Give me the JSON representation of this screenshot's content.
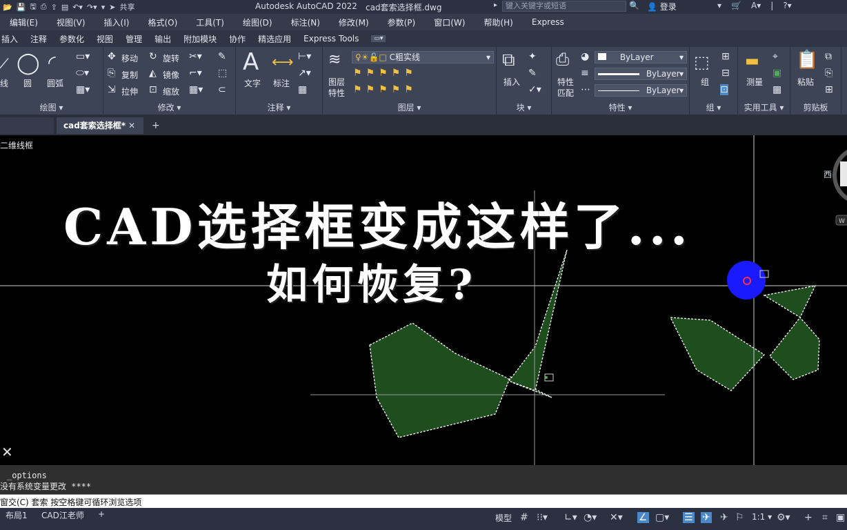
{
  "titlebar": {
    "share": "共享",
    "app": "Autodesk AutoCAD 2022",
    "document": "cad套索选择框.dwg",
    "search_placeholder": "键入关键字或短语",
    "login": "登录"
  },
  "menubar": [
    "编辑(E)",
    "视图(V)",
    "插入(I)",
    "格式(O)",
    "工具(T)",
    "绘图(D)",
    "标注(N)",
    "修改(M)",
    "参数(P)",
    "窗口(W)",
    "帮助(H)",
    "Express"
  ],
  "ribbon_tabs": [
    "插入",
    "注释",
    "参数化",
    "视图",
    "管理",
    "输出",
    "附加模块",
    "协作",
    "精选应用",
    "Express Tools"
  ],
  "ribbon": {
    "draw": {
      "label": "绘图",
      "line": "线",
      "circle": "圆",
      "arc": "圆弧"
    },
    "modify": {
      "label": "修改",
      "move": "移动",
      "rotate": "旋转",
      "copy": "复制",
      "mirror": "镜像",
      "stretch": "拉伸",
      "scale": "缩放"
    },
    "annotate": {
      "label": "注释",
      "text": "文字",
      "dim": "标注"
    },
    "layers": {
      "label": "图层",
      "layer_props_1": "图层",
      "layer_props_2": "特性",
      "current_layer": "C粗实线"
    },
    "block": {
      "label": "块",
      "insert": "插入"
    },
    "properties": {
      "label": "特性",
      "match_1": "特性",
      "match_2": "匹配",
      "color": "ByLayer",
      "linetype": "ByLayer",
      "lineweight": "ByLayer"
    },
    "groups": {
      "label": "组",
      "group": "组"
    },
    "utilities": {
      "label": "实用工具",
      "measure": "测量"
    },
    "clipboard": {
      "label": "剪贴板",
      "paste": "粘贴"
    }
  },
  "doctabs": {
    "active": "cad套索选择框*"
  },
  "canvas": {
    "view_label": "二维线框",
    "overlay_line1": "CAD选择框变成这样了...",
    "overlay_line2": "如何恢复?",
    "viewcube_west": "西",
    "wcs": "W"
  },
  "command": {
    "line1": "_options",
    "line2": "没有系统变量更改 ****",
    "prompt": "窗交(C) 套索  按空格键可循环浏览选项"
  },
  "statusbar": {
    "layout1": "布局1",
    "layout2": "CAD江老师",
    "model": "模型",
    "scale": "1:1"
  },
  "colors": {
    "lasso_fill": "#1e4d1e",
    "cursor_circle": "#1a1aff",
    "ribbon_bg": "#3d4455"
  }
}
